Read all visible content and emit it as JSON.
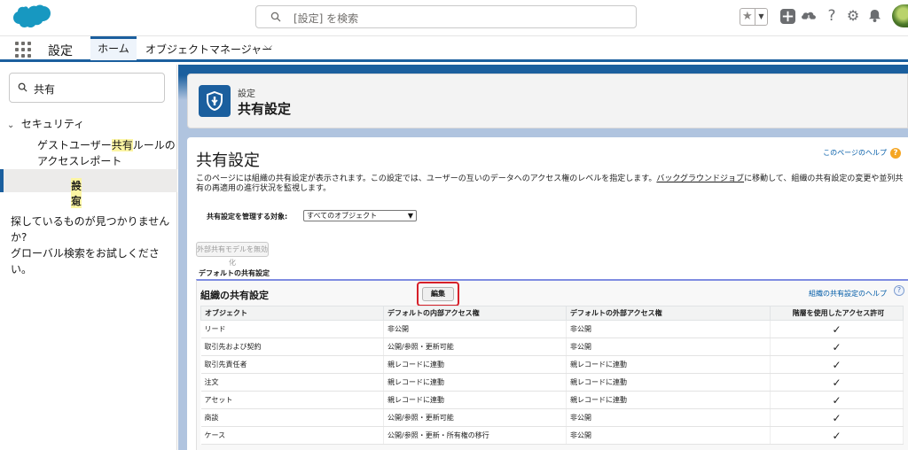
{
  "header": {
    "search_placeholder": "[設定] を検索",
    "icons": [
      "star-icon",
      "chevron-down-icon",
      "add-icon",
      "trailhead-icon",
      "help-icon",
      "gear-icon",
      "bell-icon",
      "avatar"
    ]
  },
  "context_bar": {
    "app_name": "設定",
    "tabs": [
      {
        "label": "ホーム",
        "active": true
      },
      {
        "label": "オブジェクトマネージャー",
        "active": false
      }
    ]
  },
  "left_panel": {
    "search_value": "共有",
    "section_label": "セキュリティ",
    "items": [
      {
        "pre": "ゲストユーザー",
        "hl": "共有",
        "post": "ルールのアクセスレポート",
        "selected": false
      },
      {
        "pre": "",
        "hl": "共有",
        "post": "設定",
        "selected": true
      }
    ],
    "not_found_text_1": "探しているものが見つかりませんか?",
    "not_found_text_2": "グローバル検索をお試しください。"
  },
  "page_header": {
    "breadcrumb": "設定",
    "title": "共有設定"
  },
  "content": {
    "title": "共有設定",
    "help_link": "このページのヘルプ",
    "description_pre": "このページには組織の共有設定が表示されます。この設定では、ユーザーの互いのデータへのアクセス権のレベルを指定します。",
    "description_link": "バックグラウンドジョブ",
    "description_post": "に移動して、組織の共有設定の変更や並列共有の再適用の進行状況を監視します。",
    "manage_label": "共有設定を管理する対象:",
    "manage_value": "すべてのオブジェクト",
    "disable_button": "外部共有モデルを無効化",
    "default_label": "デフォルトの共有設定",
    "org_section": {
      "title": "組織の共有設定",
      "edit_button": "編集",
      "help_link": "組織の共有設定のヘルプ",
      "columns": [
        "オブジェクト",
        "デフォルトの内部アクセス権",
        "デフォルトの外部アクセス権",
        "階層を使用したアクセス許可"
      ],
      "rows": [
        {
          "object": "リード",
          "internal": "非公開",
          "external": "非公開",
          "hier": "✓"
        },
        {
          "object": "取引先および契約",
          "internal": "公開/参照・更新可能",
          "external": "非公開",
          "hier": "✓"
        },
        {
          "object": "取引先責任者",
          "internal": "親レコードに連動",
          "external": "親レコードに連動",
          "hier": "✓"
        },
        {
          "object": "注文",
          "internal": "親レコードに連動",
          "external": "親レコードに連動",
          "hier": "✓"
        },
        {
          "object": "アセット",
          "internal": "親レコードに連動",
          "external": "親レコードに連動",
          "hier": "✓"
        },
        {
          "object": "商談",
          "internal": "公開/参照・更新可能",
          "external": "非公開",
          "hier": "✓"
        },
        {
          "object": "ケース",
          "internal": "公開/参照・更新・所有権の移行",
          "external": "非公開",
          "hier": "✓"
        }
      ]
    }
  },
  "colors": {
    "brand": "#1b5f9e",
    "highlight": "#fcf5a3",
    "edit_outline": "#d6202a",
    "link": "#015ba7"
  }
}
